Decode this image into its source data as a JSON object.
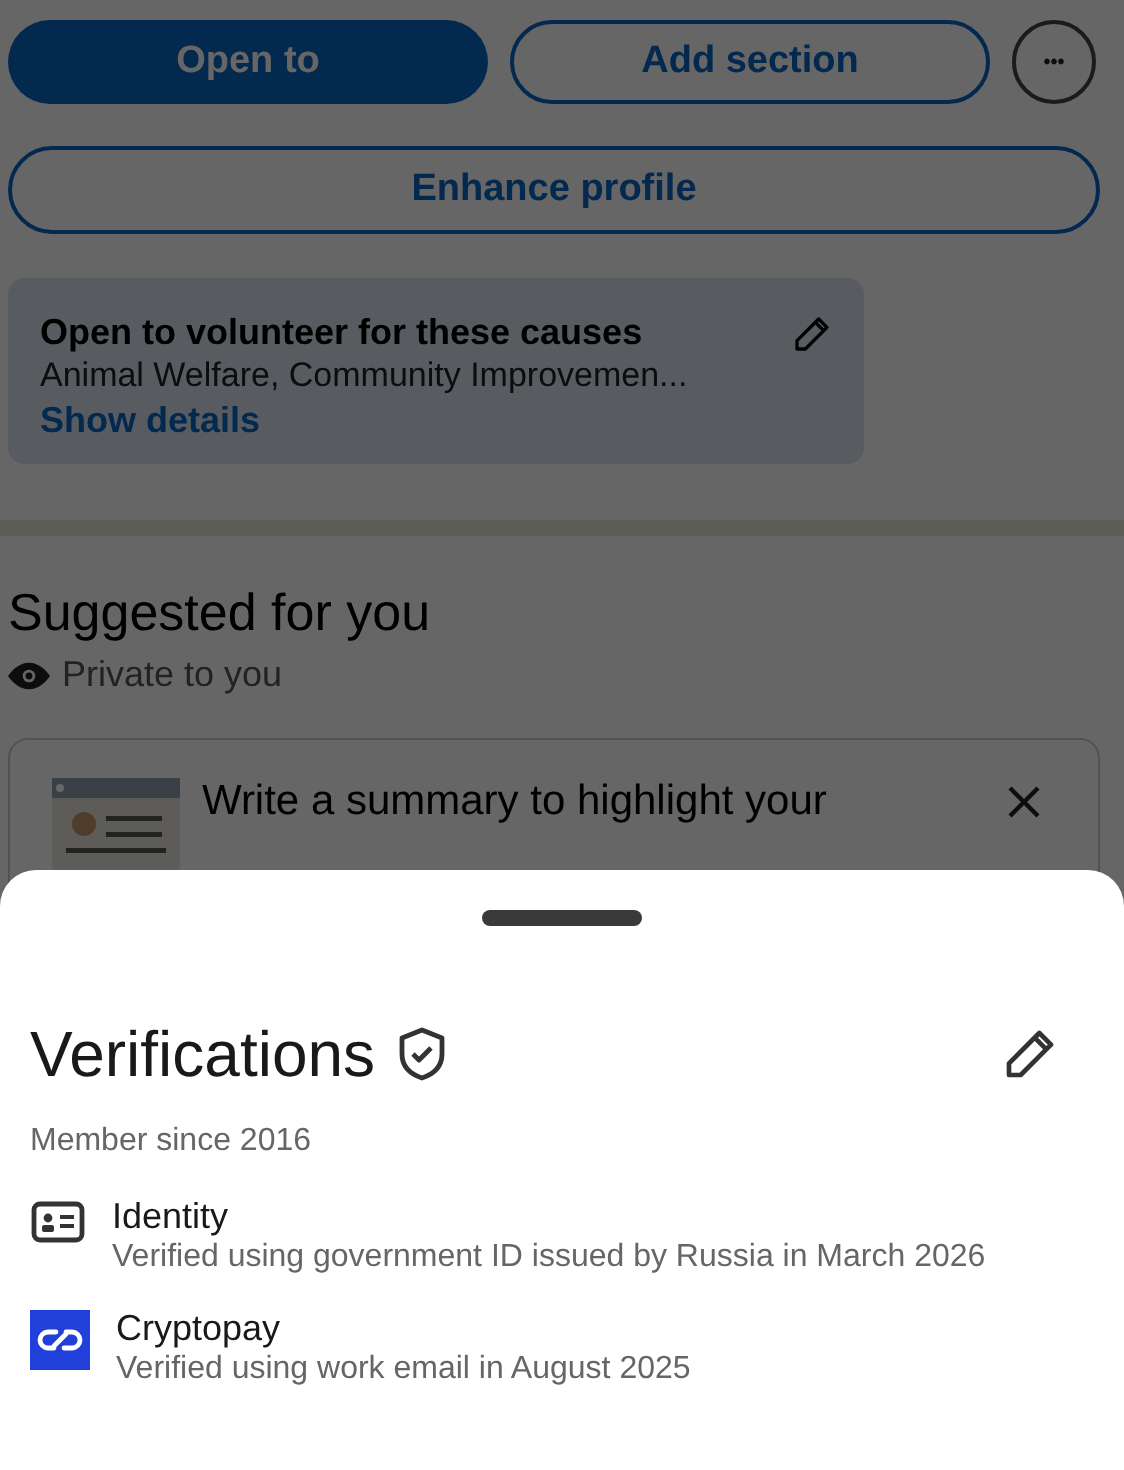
{
  "profile_actions": {
    "primary": "Open to",
    "secondary": "Add section",
    "more": "•••",
    "enhance": "Enhance profile"
  },
  "open_to_card": {
    "title": "Open to volunteer for these causes",
    "causes": "Animal Welfare, Community Improvemen...",
    "link": "Show details"
  },
  "suggested": {
    "title": "Suggested for you",
    "privacy": "Private to you",
    "card_text": "Write a summary to highlight your"
  },
  "sheet": {
    "title": "Verifications",
    "subtitle": "Member since 2016",
    "items": [
      {
        "kind": "id",
        "title": "Identity",
        "detail": "Verified using government ID issued by Russia in March 2026"
      },
      {
        "kind": "logo",
        "title": "Cryptopay",
        "detail": "Verified using work email in August 2025"
      }
    ]
  }
}
